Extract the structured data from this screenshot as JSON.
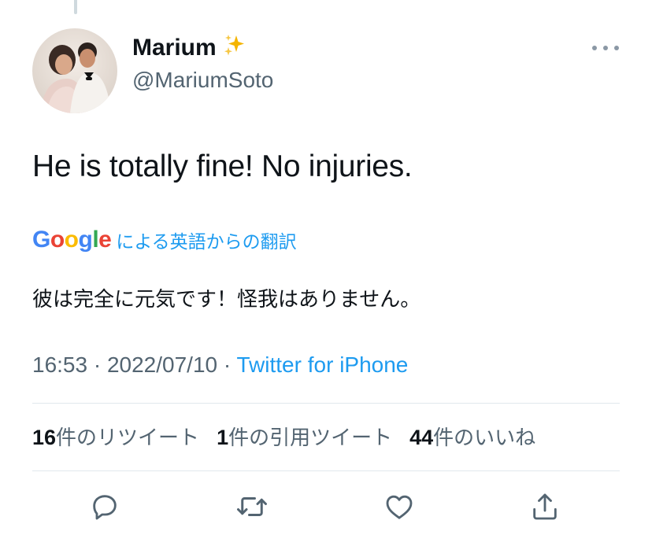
{
  "user": {
    "display_name": "Marium",
    "name_emoji": "sparkles-icon",
    "handle": "@MariumSoto"
  },
  "tweet": {
    "text": "He is totally fine! No injuries.",
    "translation_provider": "Google",
    "translation_label": "による英語からの翻訳",
    "translated_text": "彼は完全に元気です！怪我はありません。"
  },
  "meta": {
    "time": "16:53",
    "separator": "·",
    "date": "2022/07/10",
    "source": "Twitter for iPhone"
  },
  "stats": {
    "retweets_count": "16",
    "retweets_label": "件のリツイート",
    "quotes_count": "1",
    "quotes_label": "件の引用ツイート",
    "likes_count": "44",
    "likes_label": "件のいいね"
  },
  "colors": {
    "link": "#1d9bf0",
    "secondary_text": "#536471",
    "divider": "#e1e8ed"
  },
  "actions": [
    "reply-icon",
    "retweet-icon",
    "like-icon",
    "share-icon"
  ]
}
